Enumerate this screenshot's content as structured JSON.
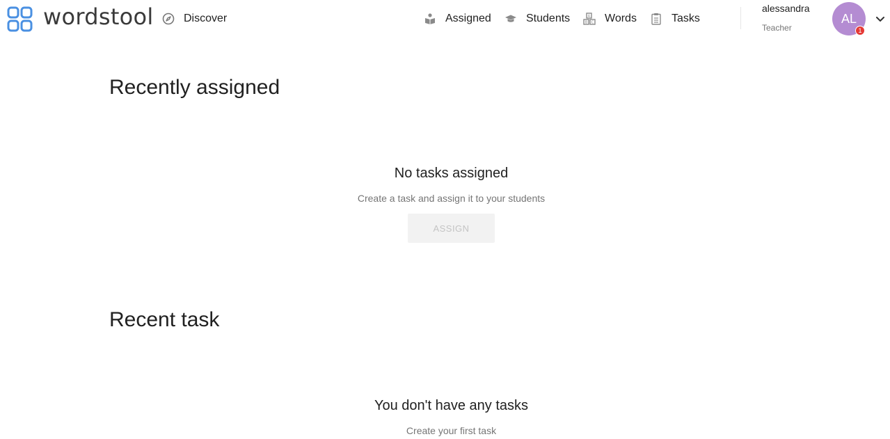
{
  "header": {
    "logo_text": "wordstool",
    "discover_label": "Discover",
    "nav": {
      "assigned": "Assigned",
      "students": "Students",
      "words": "Words",
      "tasks": "Tasks"
    },
    "user": {
      "name": "alessandra",
      "role": "Teacher",
      "initials": "AL",
      "notification_count": "1"
    }
  },
  "recently_assigned": {
    "title": "Recently assigned",
    "empty_title": "No tasks assigned",
    "empty_subtitle": "Create a task and assign it to your students",
    "button_label": "ASSIGN"
  },
  "recent_task": {
    "title": "Recent task",
    "empty_title": "You don't have any tasks",
    "empty_subtitle": "Create your first task"
  },
  "colors": {
    "logo_blue": "#4a90e2",
    "avatar": "#b48cd2",
    "badge": "#e53935"
  }
}
